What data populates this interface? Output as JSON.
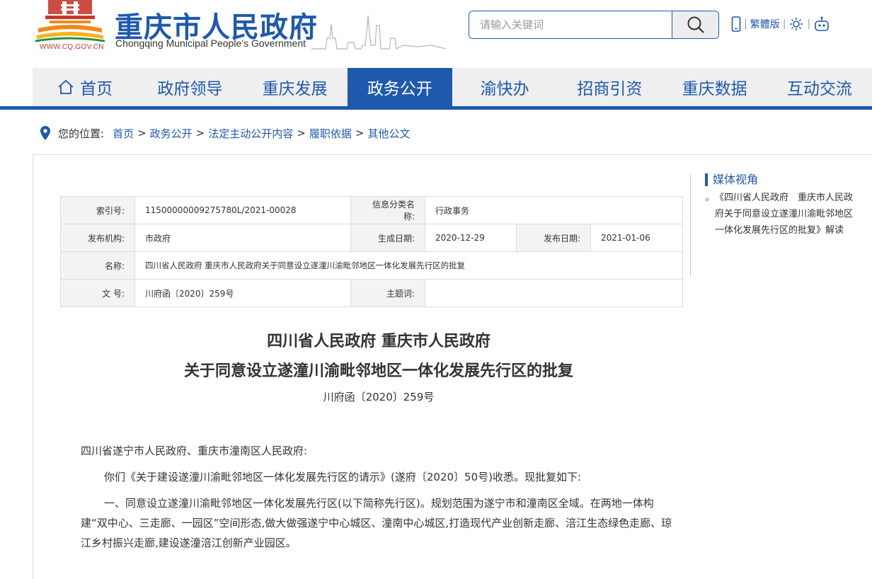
{
  "header": {
    "logo_url": "WWW.CQ.GOV.CN",
    "title": "重庆市人民政府",
    "subtitle": "Chongqing Municipal People’s Government",
    "search_placeholder": "请输入关键词",
    "traditional_label": "繁體版"
  },
  "nav": {
    "items": [
      "首页",
      "政府领导",
      "重庆发展",
      "政务公开",
      "渝快办",
      "招商引资",
      "重庆数据",
      "互动交流"
    ],
    "active_index": 3
  },
  "breadcrumb": {
    "prefix": "您的位置:",
    "items": [
      "首页",
      "政务公开",
      "法定主动公开内容",
      "履职依据",
      "其他公文"
    ],
    "separator": ">"
  },
  "meta": {
    "index_label": "索引号:",
    "index_value": "11500000009275780L/2021-00028",
    "category_label": "信息分类名称:",
    "category_value": "行政事务",
    "issuer_label": "发布机构:",
    "issuer_value": "市政府",
    "created_label": "生成日期:",
    "created_value": "2020-12-29",
    "published_label": "发布日期:",
    "published_value": "2021-01-06",
    "name_label": "名称:",
    "name_value": "四川省人民政府 重庆市人民政府关于同意设立遂潼川渝毗邻地区一体化发展先行区的批复",
    "docno_label": "文 号:",
    "docno_value": "川府函〔2020〕259号",
    "subject_label": "主题词:",
    "subject_value": ""
  },
  "document": {
    "title_line1": "四川省人民政府  重庆市人民政府",
    "title_line2": "关于同意设立遂潼川渝毗邻地区一体化发展先行区的批复",
    "number": "川府函〔2020〕259号",
    "salutation": "四川省遂宁市人民政府、重庆市潼南区人民政府:",
    "para1": "你们《关于建设遂潼川渝毗邻地区一体化发展先行区的请示》(遂府〔2020〕50号)收悉。现批复如下:",
    "para2": "一、同意设立遂潼川渝毗邻地区一体化发展先行区(以下简称先行区)。规划范围为遂宁市和潼南区全域。在两地一体构建“双中心、三走廊、一园区”空间形态,做大做强遂宁中心城区、潼南中心城区,打造现代产业创新走廊、涪江生态绿色走廊、琼江乡村振兴走廊,建设遂潼涪江创新产业园区。"
  },
  "sidebar": {
    "title": "媒体视角",
    "item": "《四川省人民政府　重庆市人民政府关于同意设立遂潼川渝毗邻地区一体化发展先行区的批复》解读"
  },
  "colors": {
    "brand_blue": "#1e59ad",
    "logo_red": "#c8372d",
    "logo_orange": "#f08a1c"
  }
}
